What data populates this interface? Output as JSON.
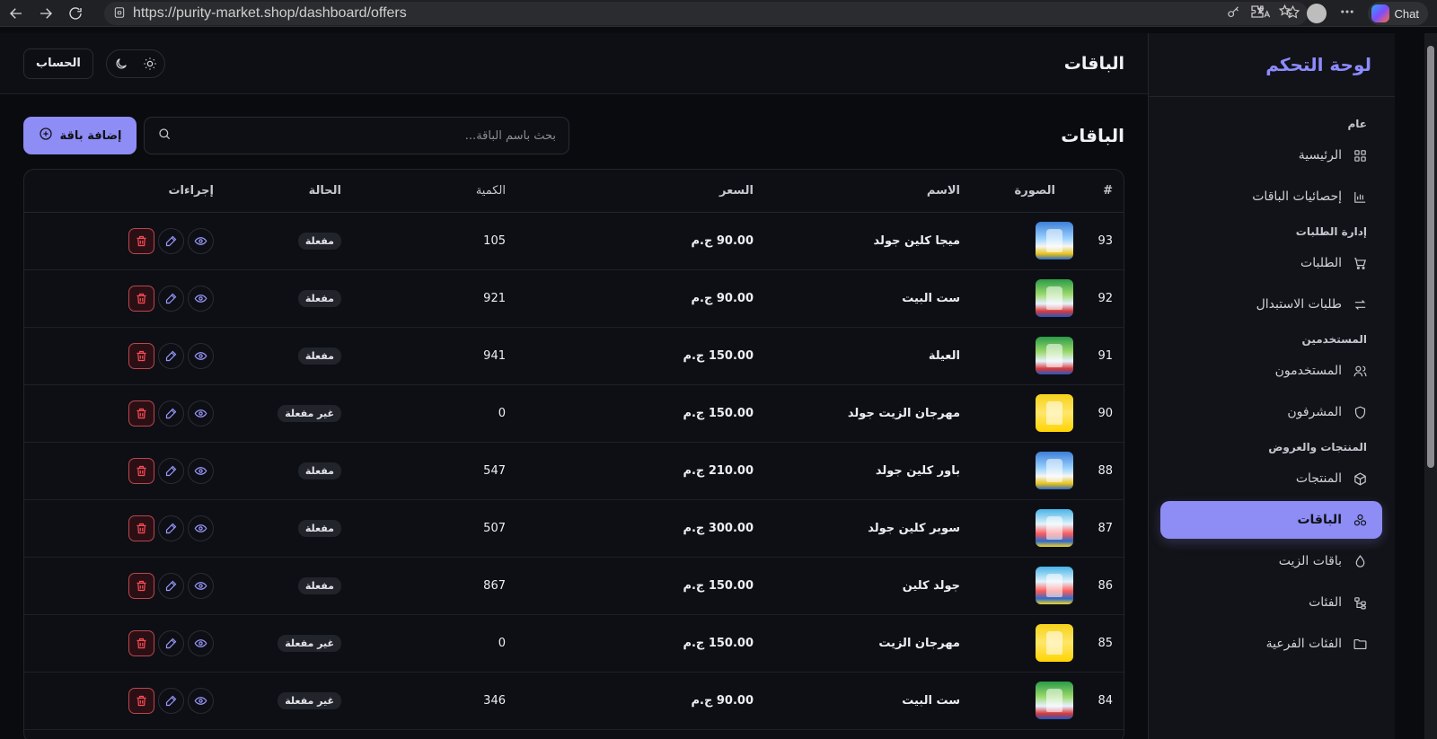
{
  "browser": {
    "url": "https://purity-market.shop/dashboard/offers",
    "chat_label": "Chat"
  },
  "sidebar": {
    "brand": "لوحة التحكم",
    "sections": [
      {
        "title": "عام",
        "items": [
          {
            "label": "الرئيسية",
            "icon": "grid-icon"
          },
          {
            "label": "إحصائيات الباقات",
            "icon": "bar-chart-icon"
          }
        ]
      },
      {
        "title": "إدارة الطلبات",
        "items": [
          {
            "label": "الطلبات",
            "icon": "cart-icon"
          },
          {
            "label": "طلبات الاستبدال",
            "icon": "swap-icon"
          }
        ]
      },
      {
        "title": "المستخدمين",
        "items": [
          {
            "label": "المستخدمون",
            "icon": "users-icon"
          },
          {
            "label": "المشرفون",
            "icon": "shield-icon"
          }
        ]
      },
      {
        "title": "المنتجات والعروض",
        "items": [
          {
            "label": "المنتجات",
            "icon": "box-icon"
          },
          {
            "label": "الباقات",
            "icon": "packages-icon",
            "active": true
          },
          {
            "label": "باقات الزيت",
            "icon": "drop-icon"
          },
          {
            "label": "الفئات",
            "icon": "tree-icon"
          },
          {
            "label": "الفئات الفرعية",
            "icon": "folder-icon"
          }
        ]
      }
    ]
  },
  "topbar": {
    "title": "الباقات",
    "account_label": "الحساب"
  },
  "content": {
    "title": "الباقات",
    "search_placeholder": "بحث باسم الباقة...",
    "add_label": "إضافة باقة"
  },
  "table": {
    "headers": {
      "id": "#",
      "image": "الصورة",
      "name": "الاسم",
      "price": "السعر",
      "quantity": "الكمية",
      "status": "الحالة",
      "actions": "إجراءات"
    },
    "rows": [
      {
        "id": "93",
        "name": "ميجا كلين جولد",
        "price": "90.00 ج.م",
        "quantity": "105",
        "status": "مفعلة",
        "pack": "blue"
      },
      {
        "id": "92",
        "name": "ست البيت",
        "price": "90.00 ج.م",
        "quantity": "921",
        "status": "مفعلة",
        "pack": "green"
      },
      {
        "id": "91",
        "name": "العيلة",
        "price": "150.00 ج.م",
        "quantity": "941",
        "status": "مفعلة",
        "pack": "green"
      },
      {
        "id": "90",
        "name": "مهرجان الزيت جولد",
        "price": "150.00 ج.م",
        "quantity": "0",
        "status": "غير مفعلة",
        "pack": "yellow"
      },
      {
        "id": "88",
        "name": "باور كلين جولد",
        "price": "210.00 ج.م",
        "quantity": "547",
        "status": "مفعلة",
        "pack": "blue"
      },
      {
        "id": "87",
        "name": "سوبر كلين جولد",
        "price": "300.00 ج.م",
        "quantity": "507",
        "status": "مفعلة",
        "pack": "cyan"
      },
      {
        "id": "86",
        "name": "جولد كلين",
        "price": "150.00 ج.م",
        "quantity": "867",
        "status": "مفعلة",
        "pack": "cyan"
      },
      {
        "id": "85",
        "name": "مهرجان الزيت",
        "price": "150.00 ج.م",
        "quantity": "0",
        "status": "غير مفعلة",
        "pack": "yellow"
      },
      {
        "id": "84",
        "name": "ست البيت",
        "price": "90.00 ج.م",
        "quantity": "346",
        "status": "غير مفعلة",
        "pack": "green"
      }
    ]
  },
  "colors": {
    "accent": "#8e8cf5",
    "brand": "#8d8bff",
    "danger": "#ff4b55",
    "background": "#0a0b0f",
    "surface": "#0e0f14"
  }
}
